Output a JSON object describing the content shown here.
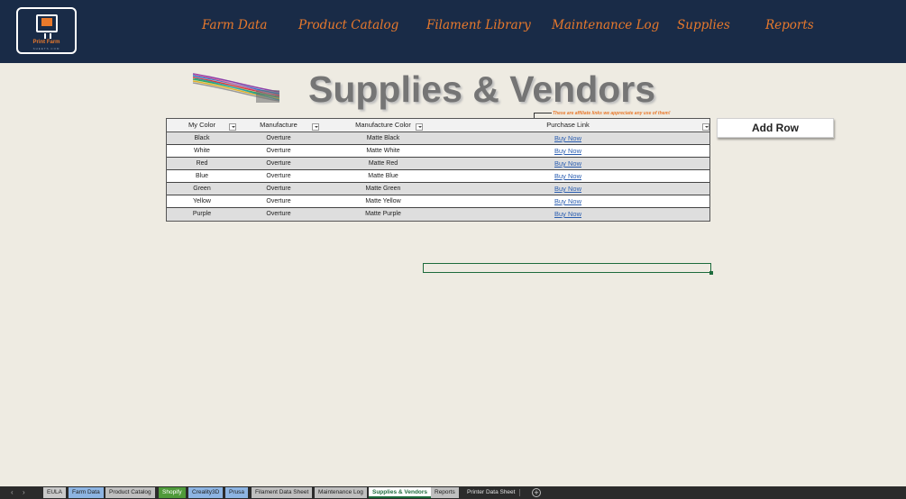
{
  "nav": {
    "logo_name": "Print Farm",
    "logo_sub": "SHEETS.COM",
    "items": [
      "Farm Data",
      "Product Catalog",
      "Filament Library",
      "Maintenance Log",
      "Supplies",
      "Reports"
    ]
  },
  "page": {
    "title": "Supplies & Vendors",
    "affiliate_note": "These are affiliate links we appreciate any use of them!",
    "add_row_label": "Add Row"
  },
  "table": {
    "headers": [
      "My Color",
      "Manufacture",
      "Manufacture Color",
      "Purchase Link"
    ],
    "rows": [
      [
        "Black",
        "Overture",
        "Matte Black",
        "Buy Now"
      ],
      [
        "White",
        "Overture",
        "Matte White",
        "Buy Now"
      ],
      [
        "Red",
        "Overture",
        "Matte Red",
        "Buy Now"
      ],
      [
        "Blue",
        "Overture",
        "Matte Blue",
        "Buy Now"
      ],
      [
        "Green",
        "Overture",
        "Matte Green",
        "Buy Now"
      ],
      [
        "Yellow",
        "Overture",
        "Matte Yellow",
        "Buy Now"
      ],
      [
        "Purple",
        "Overture",
        "Matte Purple",
        "Buy Now"
      ]
    ]
  },
  "sheet_tabs": {
    "items": [
      {
        "label": "EULA",
        "color": "#c9c9c9"
      },
      {
        "label": "Farm Data",
        "color": "#8db4e2"
      },
      {
        "label": "Product Catalog",
        "color": "#bfbfbf"
      },
      {
        "label": "Shopify",
        "color": "#4f9a3a"
      },
      {
        "label": "Creality3D",
        "color": "#8db4e2"
      },
      {
        "label": "Prusa",
        "color": "#8db4e2"
      },
      {
        "label": "Filament Data Sheet",
        "color": "#bfbfbf"
      },
      {
        "label": "Maintenance Log",
        "color": "#bfbfbf"
      },
      {
        "label": "Supplies & Vendors",
        "color": "#ffffff"
      },
      {
        "label": "Reports",
        "color": "#bfbfbf"
      },
      {
        "label": "Printer Data Sheet",
        "color": "none"
      }
    ],
    "active": "Supplies & Vendors",
    "add_sheet": "+"
  },
  "colors": {
    "nav_bg": "#192b47",
    "accent": "#e8792c",
    "page_bg": "#eeebe2",
    "link": "#2a5db0",
    "selection": "#1d6b3c"
  }
}
